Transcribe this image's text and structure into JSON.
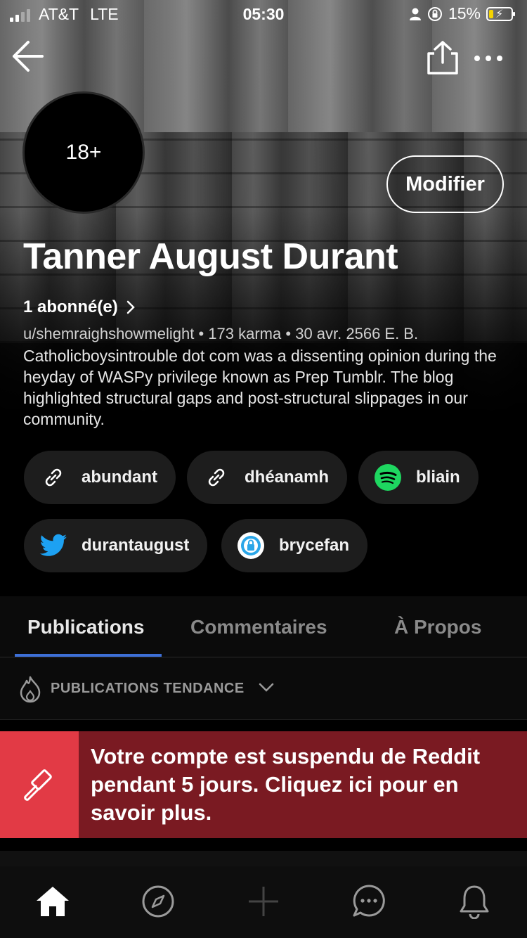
{
  "status_bar": {
    "carrier": "AT&T",
    "network": "LTE",
    "time": "05:30",
    "battery": "15%",
    "icons": [
      "signal-icon",
      "person-icon",
      "orientation-lock-icon",
      "battery-charging-icon"
    ]
  },
  "header": {
    "back_icon": "arrow-left-icon",
    "share_icon": "share-icon",
    "more_icon": "more-dots-icon"
  },
  "profile": {
    "avatar_label": "18+",
    "edit_label": "Modifier",
    "name": "Tanner August Durant",
    "followers": "1 abonné(e)",
    "username": "u/shemraighshowmelight",
    "karma": "173 karma",
    "cake_day": "30 avr. 2566 E. B.",
    "bio": "Catholicboysintrouble dot com was a dissenting opinion during the heyday of WASPy privilege known as Prep Tumblr. The blog highlighted structural gaps and post-structural slippages in our community."
  },
  "social_links": [
    {
      "label": "abundant",
      "icon": "link-icon"
    },
    {
      "label": "dhéanamh",
      "icon": "link-icon"
    },
    {
      "label": "bliain",
      "icon": "spotify-icon"
    },
    {
      "label": "durantaugust",
      "icon": "twitter-icon"
    },
    {
      "label": "brycefan",
      "icon": "onlyfans-icon"
    }
  ],
  "tabs": [
    {
      "label": "Publications",
      "active": true
    },
    {
      "label": "Commentaires",
      "active": false
    },
    {
      "label": "À Propos",
      "active": false
    }
  ],
  "sort": {
    "label": "PUBLICATIONS TENDANCE",
    "icon": "flame-icon"
  },
  "suspension": {
    "message": "Votre compte est suspendu de Reddit pendant 5 jours. Cliquez ici pour en savoir plus.",
    "icon": "gavel-icon",
    "colors": {
      "icon_bg": "#e23a45",
      "bg": "#7a1a22"
    }
  },
  "bottom_nav": [
    {
      "name": "home",
      "icon": "home-icon"
    },
    {
      "name": "discover",
      "icon": "compass-icon"
    },
    {
      "name": "create",
      "icon": "plus-icon"
    },
    {
      "name": "chat",
      "icon": "chat-icon"
    },
    {
      "name": "notifications",
      "icon": "bell-icon"
    }
  ],
  "colors": {
    "accent": "#3d6fd6",
    "chip_bg": "#1d1d1d"
  }
}
